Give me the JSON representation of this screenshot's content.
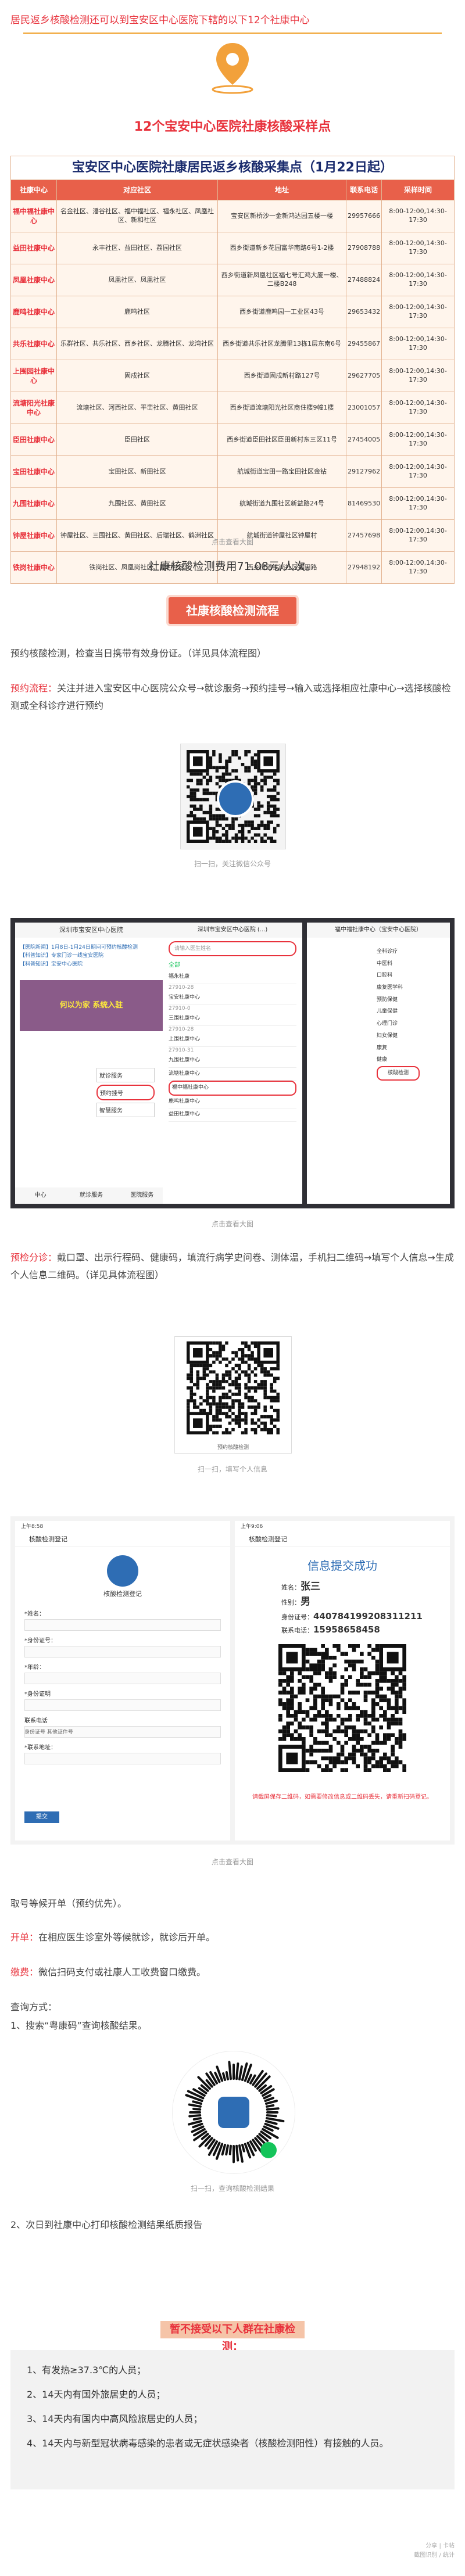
{
  "intro": "居民返乡核酸检测还可以到宝安区中心医院下辖的以下12个社康中心",
  "section_heading": {
    "count": "12个",
    "rest": "宝安中心医院社康核酸采样点"
  },
  "table": {
    "title": "宝安区中心医院社康居民返乡核酸采集点（1月22日起）",
    "headers": [
      "社康中心",
      "对应社区",
      "地址",
      "联系电话",
      "采样时间"
    ],
    "rows": [
      {
        "name": "福中福社康中心",
        "community": "名金社区、潘谷社区、福中福社区、福永社区、凤凰社区、新和社区",
        "address": "宝安区新桥沙一金新鸿达园五楼一楼",
        "phone": "29957666",
        "time": "8:00-12:00,14:30-17:30"
      },
      {
        "name": "益田社康中心",
        "community": "永丰社区、益田社区、荔园社区",
        "address": "西乡街道新乡花园富华南路6号1-2楼",
        "phone": "27908788",
        "time": "8:00-12:00,14:30-17:30"
      },
      {
        "name": "凤凰社康中心",
        "community": "凤凰社区、凤凰社区",
        "address": "西乡街道新凤凰社区福七号汇鸿大厦一楼、二楼B248",
        "phone": "27488824",
        "time": "8:00-12:00,14:30-17:30"
      },
      {
        "name": "鹿鸣社康中心",
        "community": "鹿鸣社区",
        "address": "西乡街道鹿鸣园一工业区43号",
        "phone": "29653432",
        "time": "8:00-12:00,14:30-17:30"
      },
      {
        "name": "共乐社康中心",
        "community": "乐群社区、共乐社区、西乡社区、龙腾社区、龙湾社区",
        "address": "西乡街道共乐社区龙腾里13栋1层东南6号",
        "phone": "29455867",
        "time": "8:00-12:00,14:30-17:30"
      },
      {
        "name": "上围园社康中心",
        "community": "固戍社区",
        "address": "西乡街道固戍新村路127号",
        "phone": "29627705",
        "time": "8:00-12:00,14:30-17:30"
      },
      {
        "name": "流塘阳光社康中心",
        "community": "流塘社区、河西社区、平峦社区、黄田社区",
        "address": "西乡街道流塘阳光社区商住楼9幢1楼",
        "phone": "23001057",
        "time": "8:00-12:00,14:30-17:30"
      },
      {
        "name": "臣田社康中心",
        "community": "臣田社区",
        "address": "西乡街道臣田社区臣田新村东三区11号",
        "phone": "27454005",
        "time": "8:00-12:00,14:30-17:30"
      },
      {
        "name": "宝田社康中心",
        "community": "宝田社区、新田社区",
        "address": "航城街道宝田一路宝田社区金钻",
        "phone": "29127962",
        "time": "8:00-12:00,14:30-17:30"
      },
      {
        "name": "九围社康中心",
        "community": "九围社区、黄田社区",
        "address": "航城街道九围社区新益路24号",
        "phone": "81469530",
        "time": "8:00-12:00,14:30-17:30"
      },
      {
        "name": "钟屋社康中心",
        "community": "钟屋社区、三围社区、黄田社区、后瑞社区、鹤洲社区",
        "address": "航城街道钟屋社区钟屋村",
        "phone": "27457698",
        "time": "8:00-12:00,14:30-17:30"
      },
      {
        "name": "铁岗社康中心",
        "community": "铁岗社区、凤凰岗社区、屋村社区",
        "address": "西乡街道铁岗社区福田路",
        "phone": "27948192",
        "time": "8:00-12:00,14:30-17:30"
      }
    ]
  },
  "caption_zoom": "点击查看大图",
  "fee": "社康核酸检测费用71.08元/人次。",
  "process_title": "社康核酸检测流程",
  "p_intro": "预约核酸检测，检查当日携带有效身份证。（详见具体流程图）",
  "p_reserve_label": "预约流程：",
  "p_reserve": "关注并进入宝安区中心医院公众号→就诊服务→预约挂号→输入或选择相应社康中心→选择核酸检测或全科诊疗进行预约",
  "qr1_caption": "扫一扫，关注微信公众号",
  "qr1_logo": "宝安区中心医院",
  "shot1": {
    "left_header": "深圳市宝安区中心医院",
    "left_items": [
      "【医院新闻】1月8日-1月24日期间可预约核酸检测",
      "【科普知识】专家门诊一线宝安医院",
      "【科普知识】宝安中心医院"
    ],
    "left_banner": "何以为家 系统入驻",
    "left_links": [
      "就诊服务",
      "预约挂号",
      "智慧服务"
    ],
    "left_tabs": [
      "中心",
      "就诊服务",
      "医院服务"
    ],
    "mid_header": "深圳市宝安区中心医院 (...)",
    "mid_search": "请输入医生姓名",
    "mid_tab": "全部",
    "mid_items": [
      "福永社康",
      "宝安社康中心",
      "三围社康中心",
      "上围社康中心",
      "九围社康中心",
      "流塘社康中心",
      "福中福社康中心",
      "鹿鸣社康中心",
      "益田社康中心"
    ],
    "mid_phones": [
      "27910-28",
      "27910-0",
      "27910-28",
      "27910-31"
    ],
    "right_header": "福中福社康中心（宝安中心医院）",
    "right_list": [
      "全科诊疗",
      "中医科",
      "口腔科",
      "康复医学科",
      "预防保健",
      "儿童保健",
      "心理门诊",
      "妇女保健",
      "康复",
      "健康",
      "核酸检测"
    ]
  },
  "p_triage_label": "预检分诊：",
  "p_triage": "戴口罩、出示行程码、健康码，填流行病学史问卷、测体温，手机扫二维码→填写个人信息→生成个人信息二维码。（详见具体流程图）",
  "qr2_caption": "扫一扫，填写个人信息",
  "qr2_sub": "预约核酸检测",
  "shot2": {
    "left_status": "上午8:58",
    "left_back": "核酸检测登记",
    "left_title": "核酸检测登记",
    "left_fields": [
      "*姓名：",
      "*身份证号：",
      "*年龄：",
      "*身份证明",
      "联系电话",
      "*联系地址："
    ],
    "left_options": "身份证号 其他证件号",
    "left_submit": "提交",
    "right_status": "上午9:06",
    "right_back": "核酸检测登记",
    "right_title": "信息提交成功",
    "right_name_label": "姓名：",
    "right_name": "张三",
    "right_sex_label": "性别：",
    "right_sex": "男",
    "right_id_label": "身份证号：",
    "right_id": "440784199208311211",
    "right_phone_label": "联系电话：",
    "right_phone": "15958658458",
    "right_notice": "请截屏保存二维码，如需要修改信息或二维码丢失，请重新扫码登记。"
  },
  "p_pay_label": "取号等候开单（预约优先）。",
  "p_order_label": "开单：",
  "p_order": "在相应医生诊室外等候就诊，就诊后开单。",
  "p_pay2_label": "缴费：",
  "p_pay2": "微信扫码支付或社康人工收费窗口缴费。",
  "p_query_label": "查询方式：",
  "p_query1": "1、搜索“粤康码”查询核酸结果。",
  "qr3_caption": "扫一扫，查询核酸检测结果",
  "p_query2": "2、次日到社康中心打印核酸检测结果纸质报告",
  "warn_head": "暂不接受以下人群在社康检测：",
  "warn_items": [
    "1、有发热≥37.3℃的人员；",
    "2、14天内有国外旅居史的人员；",
    "3、14天内有国内中高风险旅居史的人员；",
    "4、14天内与新型冠状病毒感染的患者或无症状感染者（核酸检测阳性）有接触的人员。"
  ],
  "footer": [
    "分享 | 卡帖",
    "截图识别 / 统计"
  ]
}
